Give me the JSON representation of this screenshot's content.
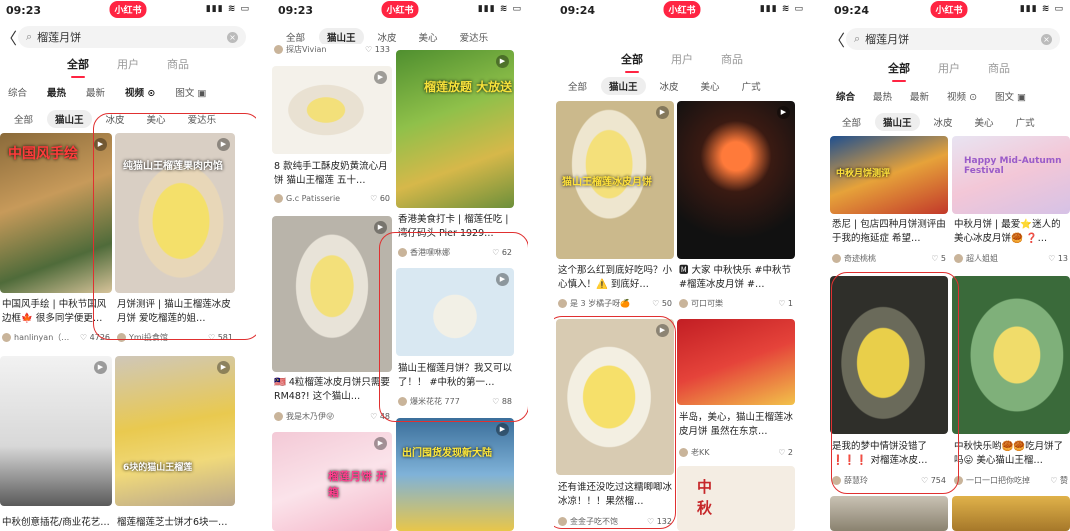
{
  "panels": [
    {
      "time": "09:23",
      "logo": "小红书",
      "signal": "▮▮▮ ≋ ▭",
      "search": {
        "back": "〈",
        "query": "榴莲月饼"
      },
      "tabs": [
        "全部",
        "用户",
        "商品"
      ],
      "sorts": [
        "综合",
        "最热",
        "最新",
        "视频 ⊙",
        "图文 ▣"
      ],
      "chips": [
        "全部",
        "猫山王",
        "冰皮",
        "美心",
        "爱达乐"
      ],
      "cards": [
        {
          "title": "中国风手绘 | 中秋节国风边框🍁 很多同学便更…",
          "user": "hanlinyan（…",
          "likes": "4726",
          "overlay": "中国风手绘"
        },
        {
          "title": "月饼测评 | 猫山王榴莲冰皮月饼 爱吃榴莲的姐…",
          "user": "Ymi投食馆",
          "likes": "581",
          "overlay": "纯猫山王榴莲果肉内馅"
        },
        {
          "title": "中秋创意插花/商业花艺…",
          "user": "",
          "likes": "",
          "overlay": ""
        },
        {
          "title": "榴莲榴莲芝士饼才6块一…",
          "user": "",
          "likes": "",
          "overlay": "6块的猫山王榴莲"
        }
      ]
    },
    {
      "time": "09:23",
      "logo": "小红书",
      "signal": "▮▮▮ ≋ ▭",
      "chips": [
        "全部",
        "猫山王",
        "冰皮",
        "美心",
        "爱达乐"
      ],
      "cards": [
        {
          "title": "",
          "user": "探店Vivian",
          "likes": "133",
          "overlay": ""
        },
        {
          "title": "8 款纯手工酥皮奶黄流心月饼 猫山王榴莲 五十…",
          "user": "G.c Patisserie",
          "likes": "60",
          "overlay": ""
        },
        {
          "title": "香港美食打卡 | 榴莲任吃 | 湾仔码头 Pier 1929…",
          "user": "香港嘿咻娜",
          "likes": "62",
          "overlay": "榴莲放题 大放送"
        },
        {
          "title": "🇲🇾 4粒榴莲冰皮月饼只需要RM48?! 这个猫山…",
          "user": "我是木乃伊😜",
          "likes": "48",
          "overlay": ""
        },
        {
          "title": "猫山王榴莲月饼？我又可以了！！ #中秋的第一…",
          "user": "爆米花花 777",
          "likes": "88",
          "overlay": ""
        },
        {
          "title": "",
          "user": "",
          "likes": "",
          "overlay": "榴莲月饼 开箱"
        },
        {
          "title": "",
          "user": "",
          "likes": "",
          "overlay": "出门囤货发现新大陆"
        }
      ]
    },
    {
      "time": "09:24",
      "logo": "小红书",
      "signal": "▮▮▮ ≋ ▭",
      "tabs": [
        "全部",
        "用户",
        "商品"
      ],
      "chips": [
        "全部",
        "猫山王",
        "冰皮",
        "美心",
        "广式"
      ],
      "cards": [
        {
          "title": "这个那么红到底好吃吗？小心慎入！⚠️ 到底好…",
          "user": "是 3 岁橘子呀🍊",
          "likes": "50",
          "overlay": "猫山王榴莲冰皮月饼"
        },
        {
          "title": "🅼 大家 中秋快乐 #中秋节 #榴莲冰皮月饼 #…",
          "user": "可口可樂",
          "likes": "1",
          "overlay": ""
        },
        {
          "title": "还有谁还没吃过这糯唧唧冰冰凉！！！果然榴…",
          "user": "金金子吃不饱",
          "likes": "132",
          "overlay": ""
        },
        {
          "title": "半岛，美心，猫山王榴莲冰皮月饼 虽然在东京…",
          "user": "老KK",
          "likes": "2",
          "overlay": ""
        },
        {
          "title": "",
          "user": "",
          "likes": "",
          "overlay": "中 秋"
        }
      ]
    },
    {
      "time": "09:24",
      "logo": "小红书",
      "signal": "▮▮▮ ≋ ▭",
      "search": {
        "back": "〈",
        "query": "榴莲月饼"
      },
      "tabs": [
        "全部",
        "用户",
        "商品"
      ],
      "sorts": [
        "综合",
        "最热",
        "最新",
        "视频 ⊙",
        "图文 ▣"
      ],
      "chips": [
        "全部",
        "猫山王",
        "冰皮",
        "美心",
        "广式"
      ],
      "cards": [
        {
          "title": "悉尼 | 包店四种月饼测评由于我的拖延症 希望…",
          "user": "奇迹桃桃",
          "likes": "5",
          "overlay": "中秋月饼测评"
        },
        {
          "title": "中秋月饼 | 最爱⭐迷人的美心冰皮月饼🥮 ❓…",
          "user": "超人姐姐",
          "likes": "13",
          "overlay": "Happy Mid-Autumn Festival"
        },
        {
          "title": "是我的梦中情饼没错了 ❗❗❗ 对榴莲冰皮…",
          "user": "薛慧玲",
          "likes": "754",
          "overlay": ""
        },
        {
          "title": "中秋快乐哟🥮🥮吃月饼了吗😛 美心猫山王榴…",
          "user": "一口一口把你吃掉",
          "likes": "赞",
          "overlay": ""
        }
      ]
    }
  ]
}
